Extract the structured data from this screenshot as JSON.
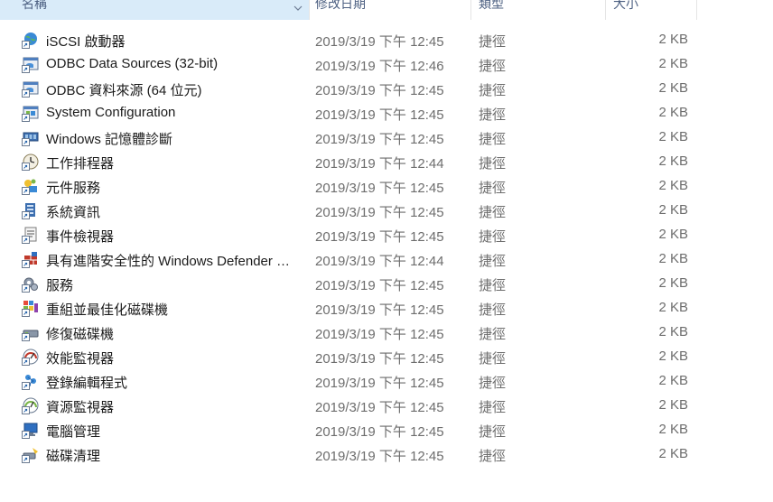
{
  "columns": {
    "name": "名稱",
    "date": "修改日期",
    "type": "類型",
    "size": "大小"
  },
  "colors": {
    "header_selected_bg": "#d9ebf9",
    "header_text": "#4d6082",
    "secondary_text": "#6d6d6d"
  },
  "rows": [
    {
      "name": "iSCSI 啟動器",
      "date": "2019/3/19 下午 12:45",
      "type": "捷徑",
      "size": "2 KB",
      "icon": "iscsi-globe-icon"
    },
    {
      "name": "ODBC Data Sources (32-bit)",
      "date": "2019/3/19 下午 12:46",
      "type": "捷徑",
      "size": "2 KB",
      "icon": "odbc-icon"
    },
    {
      "name": "ODBC 資料來源 (64 位元)",
      "date": "2019/3/19 下午 12:45",
      "type": "捷徑",
      "size": "2 KB",
      "icon": "odbc-icon"
    },
    {
      "name": "System Configuration",
      "date": "2019/3/19 下午 12:45",
      "type": "捷徑",
      "size": "2 KB",
      "icon": "system-config-icon"
    },
    {
      "name": "Windows 記憶體診斷",
      "date": "2019/3/19 下午 12:45",
      "type": "捷徑",
      "size": "2 KB",
      "icon": "memory-chip-icon"
    },
    {
      "name": "工作排程器",
      "date": "2019/3/19 下午 12:44",
      "type": "捷徑",
      "size": "2 KB",
      "icon": "clock-icon"
    },
    {
      "name": "元件服務",
      "date": "2019/3/19 下午 12:45",
      "type": "捷徑",
      "size": "2 KB",
      "icon": "component-services-icon"
    },
    {
      "name": "系統資訊",
      "date": "2019/3/19 下午 12:45",
      "type": "捷徑",
      "size": "2 KB",
      "icon": "system-info-icon"
    },
    {
      "name": "事件檢視器",
      "date": "2019/3/19 下午 12:45",
      "type": "捷徑",
      "size": "2 KB",
      "icon": "event-viewer-icon"
    },
    {
      "name": "具有進階安全性的 Windows Defender …",
      "date": "2019/3/19 下午 12:44",
      "type": "捷徑",
      "size": "2 KB",
      "icon": "firewall-icon"
    },
    {
      "name": "服務",
      "date": "2019/3/19 下午 12:45",
      "type": "捷徑",
      "size": "2 KB",
      "icon": "gears-icon"
    },
    {
      "name": "重組並最佳化磁碟機",
      "date": "2019/3/19 下午 12:45",
      "type": "捷徑",
      "size": "2 KB",
      "icon": "defrag-icon"
    },
    {
      "name": "修復磁碟機",
      "date": "2019/3/19 下午 12:45",
      "type": "捷徑",
      "size": "2 KB",
      "icon": "recovery-drive-icon"
    },
    {
      "name": "效能監視器",
      "date": "2019/3/19 下午 12:45",
      "type": "捷徑",
      "size": "2 KB",
      "icon": "performance-gauge-icon"
    },
    {
      "name": "登錄編輯程式",
      "date": "2019/3/19 下午 12:45",
      "type": "捷徑",
      "size": "2 KB",
      "icon": "registry-editor-icon"
    },
    {
      "name": "資源監視器",
      "date": "2019/3/19 下午 12:45",
      "type": "捷徑",
      "size": "2 KB",
      "icon": "resource-monitor-icon"
    },
    {
      "name": "電腦管理",
      "date": "2019/3/19 下午 12:45",
      "type": "捷徑",
      "size": "2 KB",
      "icon": "computer-management-icon"
    },
    {
      "name": "磁碟清理",
      "date": "2019/3/19 下午 12:45",
      "type": "捷徑",
      "size": "2 KB",
      "icon": "disk-cleanup-icon"
    }
  ]
}
